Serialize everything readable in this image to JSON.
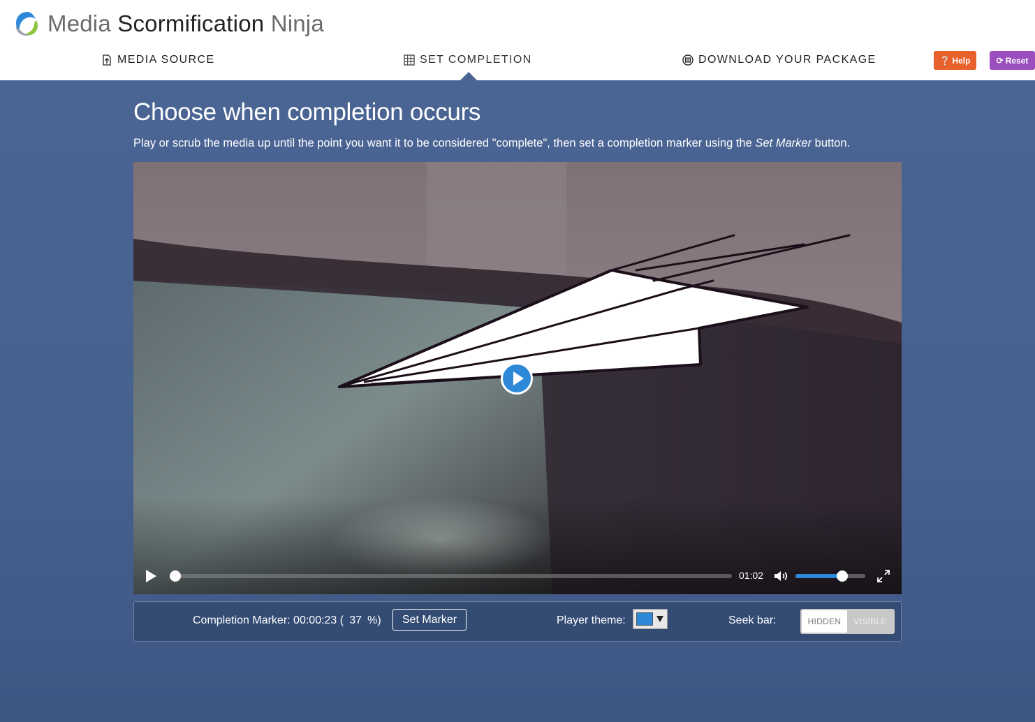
{
  "app": {
    "title_words": [
      "Media",
      "Scormification",
      "Ninja"
    ]
  },
  "nav": {
    "items": [
      {
        "label": "MEDIA SOURCE",
        "icon": "file-upload-icon"
      },
      {
        "label": "SET COMPLETION",
        "icon": "grid-icon",
        "active": true
      },
      {
        "label": "DOWNLOAD YOUR PACKAGE",
        "icon": "download-disc-icon"
      }
    ],
    "help_label": "Help",
    "help_icon": "question-circle-icon",
    "reset_label": "Reset",
    "reset_icon": "refresh-icon"
  },
  "main": {
    "title": "Choose when completion occurs",
    "instructions_before": "Play or scrub the media up until the point you want it to be considered \"complete\", then set a completion marker using the ",
    "instructions_emphasis": "Set Marker",
    "instructions_after": " button."
  },
  "player": {
    "time": "01:02",
    "seek_fraction": 0.0,
    "volume_fraction": 0.67
  },
  "options": {
    "marker_prefix": "Completion Marker: 00:00:23 (",
    "marker_percent": "37",
    "marker_suffix": "%)",
    "set_marker_label": "Set Marker",
    "theme_label": "Player theme:",
    "theme_color": "#2d89d8",
    "seekbar_label": "Seek bar:",
    "seekbar_hidden": "HIDDEN",
    "seekbar_visible": "VISIBLE",
    "seekbar_selected": "HIDDEN"
  },
  "colors": {
    "main_bg": "#4a6494",
    "help": "#e8602a",
    "reset": "#9b4fbf",
    "accent": "#2d89d8"
  }
}
